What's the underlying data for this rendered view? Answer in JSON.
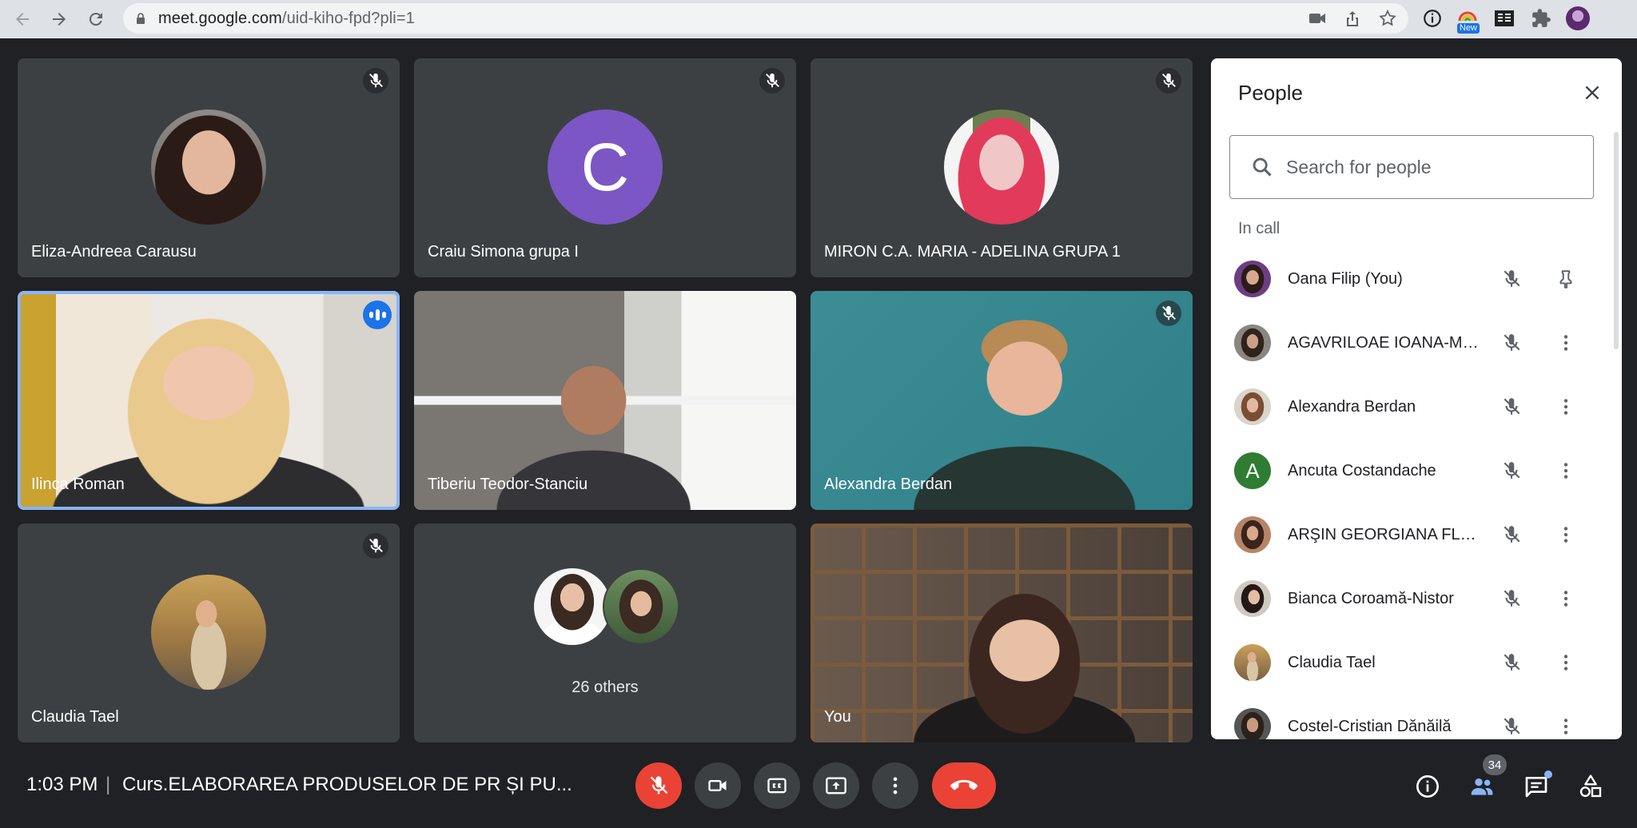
{
  "browser": {
    "url_host": "meet.google.com",
    "url_path": "/uid-kiho-fpd?pli=1",
    "new_badge": "New"
  },
  "tiles": [
    {
      "name": "Eliza-Andreea Carausu"
    },
    {
      "name": "Craiu Simona grupa I",
      "initial": "C"
    },
    {
      "name": "MIRON C.A. MARIA - ADELINA GRUPA 1"
    },
    {
      "name": "Ilinca Roman"
    },
    {
      "name": "Tiberiu Teodor-Stanciu"
    },
    {
      "name": "Alexandra Berdan"
    },
    {
      "name": "Claudia Tael"
    },
    {
      "name": "26 others"
    },
    {
      "name": "You"
    }
  ],
  "people_panel": {
    "title": "People",
    "search_placeholder": "Search for people",
    "section_label": "In call",
    "participants": [
      {
        "name": "Oana Filip (You)"
      },
      {
        "name": "AGAVRILOAE IOANA-MA..."
      },
      {
        "name": "Alexandra Berdan"
      },
      {
        "name": "Ancuta Costandache",
        "initial": "A"
      },
      {
        "name": "ARŞIN GEORGIANA FLAV..."
      },
      {
        "name": "Bianca Coroamă-Nistor"
      },
      {
        "name": "Claudia Tael"
      },
      {
        "name": "Costel-Cristian Dănăilă"
      }
    ]
  },
  "bottom_bar": {
    "time": "1:03 PM",
    "separator": "|",
    "meeting_title": "Curs.ELABORAREA PRODUSELOR DE PR ȘI PU...",
    "people_count": "34"
  },
  "colors": {
    "accent": "#1a73e8",
    "danger": "#ea4335",
    "tile_bg": "#3c4043",
    "page_bg": "#202124"
  }
}
